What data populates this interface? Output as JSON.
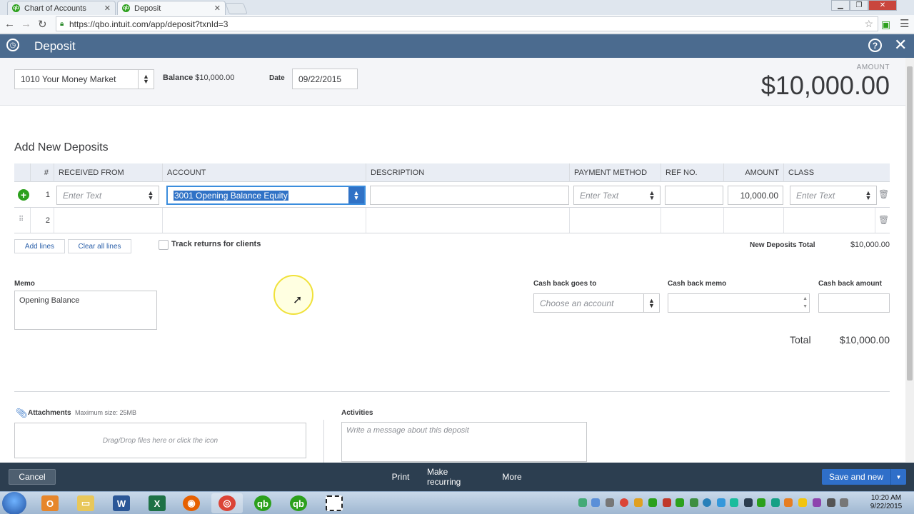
{
  "browser": {
    "tabs": [
      {
        "label": "Chart of Accounts",
        "active": false
      },
      {
        "label": "Deposit",
        "active": true
      }
    ],
    "url": "https://qbo.intuit.com/app/deposit?txnId=3"
  },
  "header": {
    "title": "Deposit",
    "help": "?",
    "close": "✕"
  },
  "top": {
    "account": "1010 Your Money Market",
    "balance_label": "Balance",
    "balance_value": "$10,000.00",
    "date_label": "Date",
    "date_value": "09/22/2015",
    "amount_label": "AMOUNT",
    "amount_value": "$10,000.00"
  },
  "deposits": {
    "title": "Add New Deposits",
    "columns": [
      "#",
      "RECEIVED FROM",
      "ACCOUNT",
      "DESCRIPTION",
      "PAYMENT METHOD",
      "REF NO.",
      "AMOUNT",
      "CLASS"
    ],
    "rows": [
      {
        "num": "1",
        "received_from_placeholder": "Enter Text",
        "account": "3001 Opening Balance Equity",
        "description": "",
        "payment_method_placeholder": "Enter Text",
        "ref_no": "",
        "amount": "10,000.00",
        "class_placeholder": "Enter Text"
      },
      {
        "num": "2"
      }
    ],
    "add_lines": "Add lines",
    "clear_all_lines": "Clear all lines",
    "track_returns": "Track returns for clients",
    "new_deposits_total_label": "New Deposits Total",
    "new_deposits_total_value": "$10,000.00"
  },
  "memo": {
    "label": "Memo",
    "value": "Opening Balance"
  },
  "cash_back": {
    "goes_to_label": "Cash back goes to",
    "goes_to_placeholder": "Choose an account",
    "memo_label": "Cash back memo",
    "amount_label": "Cash back amount"
  },
  "total": {
    "label": "Total",
    "value": "$10,000.00"
  },
  "attachments": {
    "label": "Attachments",
    "max_size": "Maximum size: 25MB",
    "drop_text": "Drag/Drop files here or click the icon"
  },
  "activities": {
    "label": "Activities",
    "placeholder": "Write a message about this deposit"
  },
  "footer": {
    "cancel": "Cancel",
    "print": "Print",
    "make_recurring": "Make recurring",
    "more": "More",
    "save_and_new": "Save and new"
  },
  "taskbar": {
    "time": "10:20 AM",
    "date": "9/22/2015"
  },
  "colors": {
    "header": "#4b6b8f",
    "footer": "#2c3e50",
    "primary": "#2f6fc9",
    "add_green": "#2ca01c",
    "selection": "#3072c6"
  }
}
